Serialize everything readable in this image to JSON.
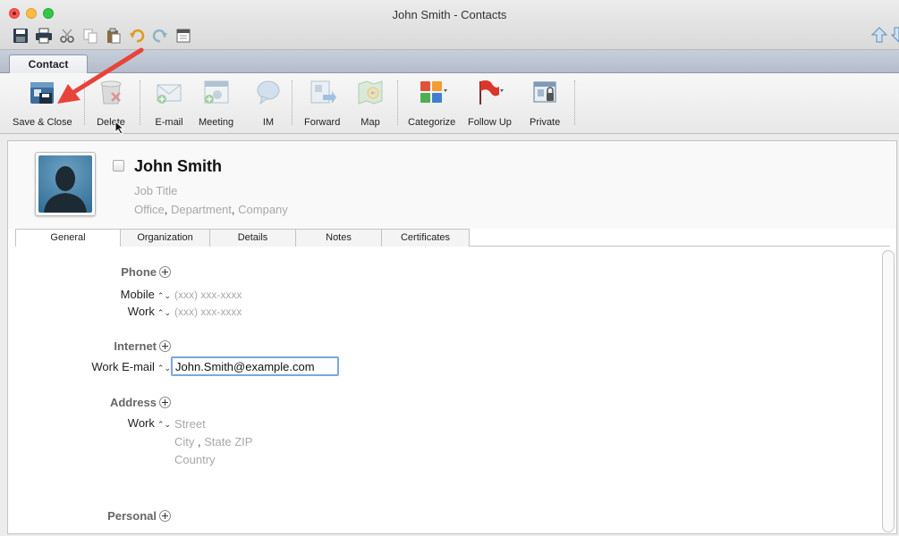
{
  "window": {
    "title": "John  Smith - Contacts"
  },
  "ribbon_tab": "Contact",
  "ribbon": {
    "buttons": [
      {
        "label": "Save & Close",
        "icon": "save-close-icon"
      },
      {
        "label": "Delete",
        "icon": "trash-icon"
      },
      {
        "label": "E-mail",
        "icon": "email-icon"
      },
      {
        "label": "Meeting",
        "icon": "calendar-icon"
      },
      {
        "label": "IM",
        "icon": "chat-bubble-icon"
      },
      {
        "label": "Forward",
        "icon": "forward-icon"
      },
      {
        "label": "Map",
        "icon": "map-icon"
      },
      {
        "label": "Categorize",
        "icon": "categorize-icon"
      },
      {
        "label": "Follow Up",
        "icon": "flag-icon"
      },
      {
        "label": "Private",
        "icon": "private-icon"
      }
    ]
  },
  "contact": {
    "name": "John  Smith",
    "job_title_placeholder": "Job Title",
    "office_placeholder": "Office",
    "department_placeholder": "Department",
    "company_placeholder": "Company",
    "org_separator": ","
  },
  "tabs": [
    "General",
    "Organization",
    "Details",
    "Notes",
    "Certificates"
  ],
  "form": {
    "phone": {
      "section": "Phone",
      "mobile_label": "Mobile",
      "mobile_placeholder": "(xxx) xxx-xxxx",
      "work_label": "Work",
      "work_placeholder": "(xxx) xxx-xxxx"
    },
    "internet": {
      "section": "Internet",
      "email_label": "Work E-mail",
      "email_value": "John.Smith@example.com"
    },
    "address": {
      "section": "Address",
      "work_label": "Work",
      "street_placeholder": "Street",
      "city_placeholder": "City",
      "city_separator": ",",
      "state_zip_placeholder": "State ZIP",
      "country_placeholder": "Country"
    },
    "personal": {
      "section": "Personal"
    }
  },
  "colors": {
    "accent_focus": "#7aa7e0",
    "annotation_arrow": "#e8433b"
  }
}
